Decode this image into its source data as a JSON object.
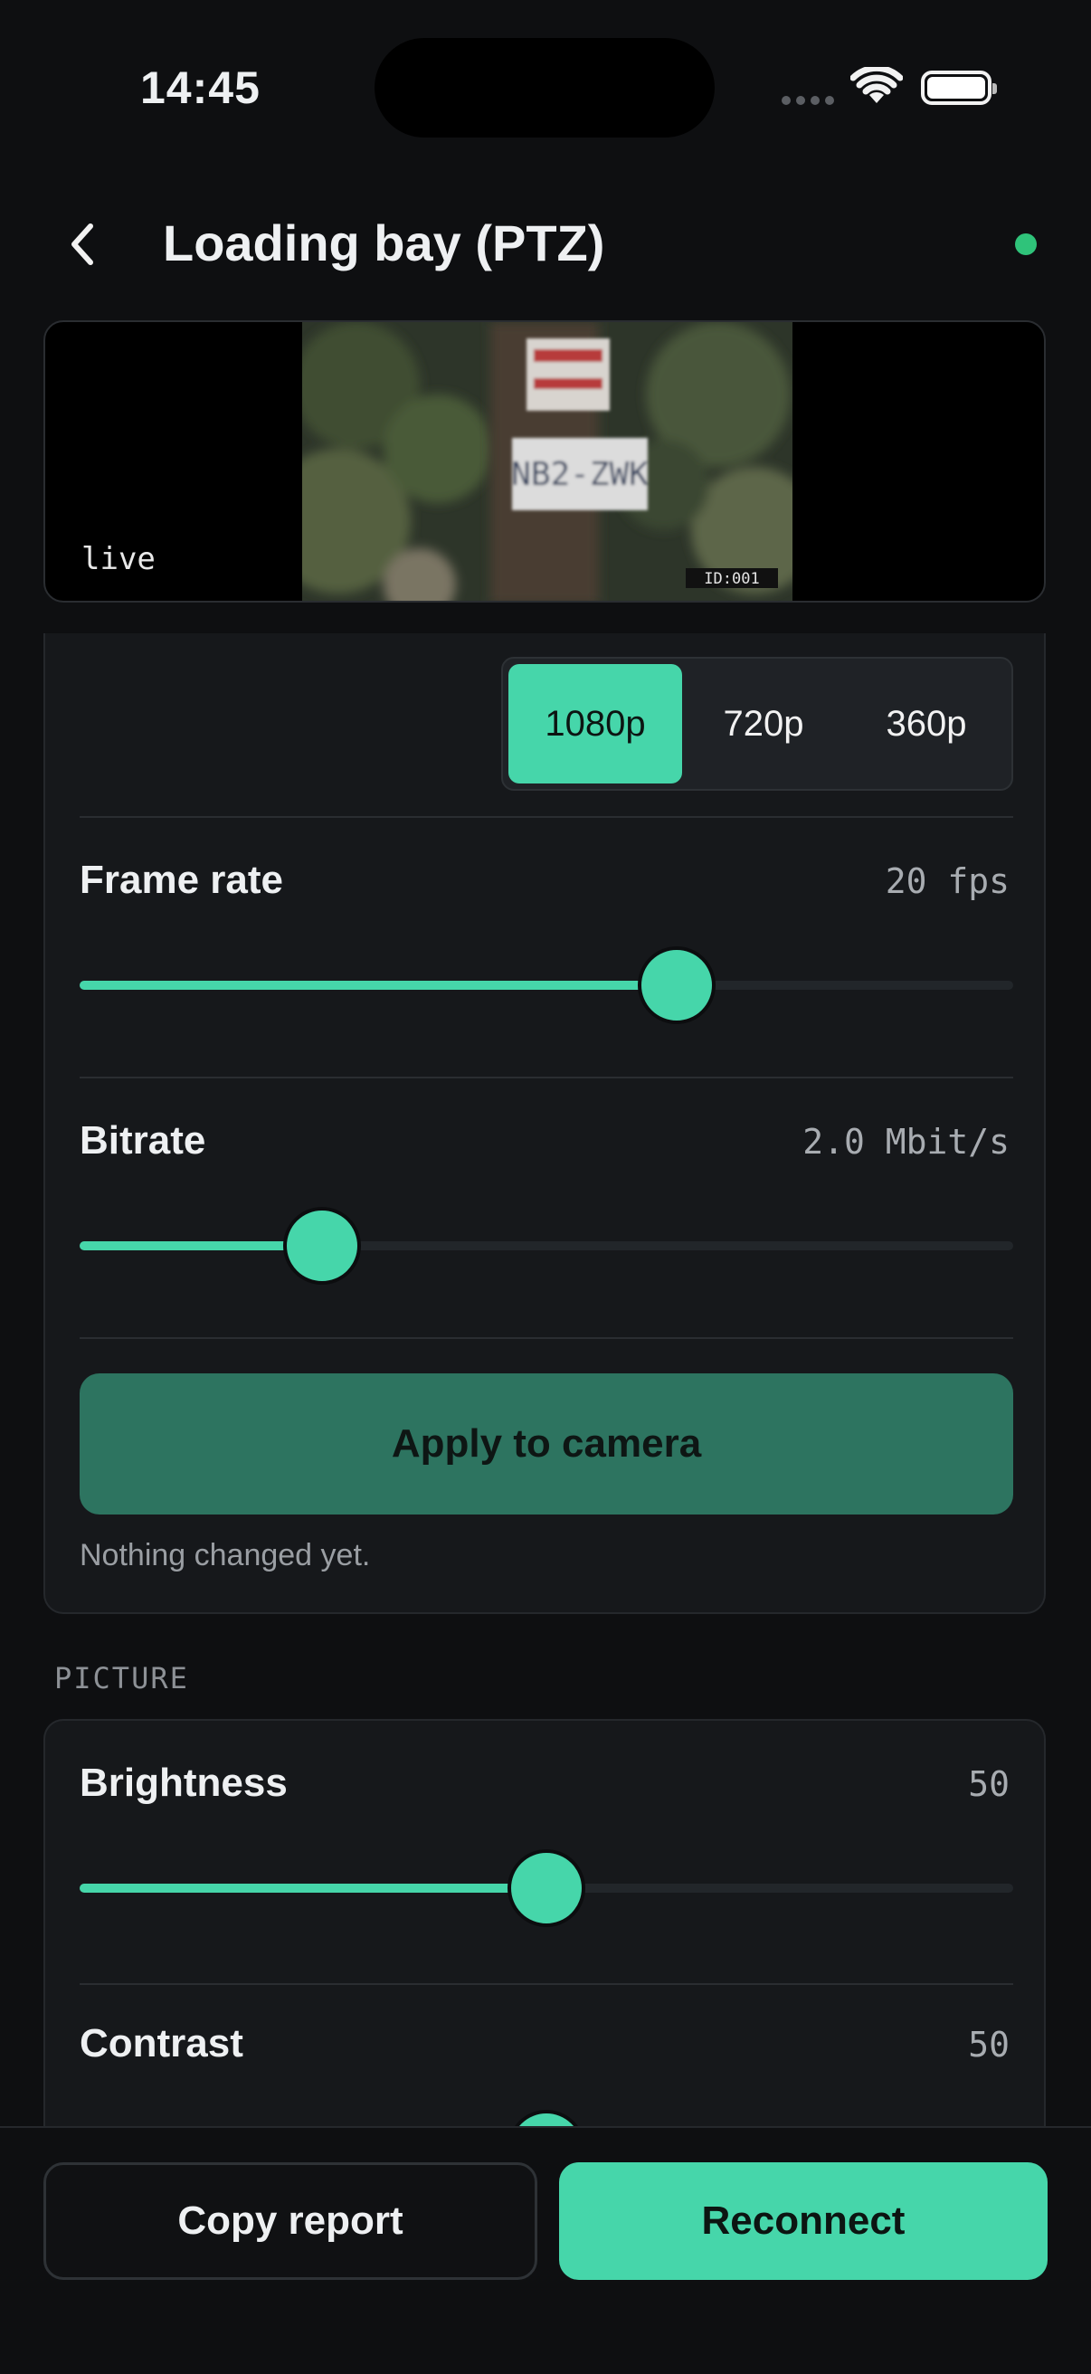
{
  "status_bar": {
    "time": "14:45"
  },
  "header": {
    "title": "Loading bay (PTZ)",
    "back_icon": "chevron-left-icon",
    "status_color": "#2fc37a"
  },
  "preview": {
    "badge": "live"
  },
  "stream": {
    "resolution_options": [
      "1080p",
      "720p",
      "360p"
    ],
    "resolution_selected": "1080p",
    "frame_rate": {
      "label": "Frame rate",
      "value": "20 fps",
      "level": 0.64
    },
    "bitrate": {
      "label": "Bitrate",
      "value": "2.0 Mbit/s",
      "level": 0.26
    },
    "apply_label": "Apply to camera",
    "note": "Nothing changed yet."
  },
  "picture": {
    "section_label": "PICTURE",
    "brightness": {
      "label": "Brightness",
      "value": "50",
      "level": 0.5
    },
    "contrast": {
      "label": "Contrast",
      "value": "50",
      "level": 0.5
    }
  },
  "actions": {
    "copy_label": "Copy report",
    "reconnect_label": "Reconnect"
  },
  "colors": {
    "accent": "#46d6aa",
    "apply_disabled": "#2d7460",
    "background": "#0e0f11",
    "card": "#16181b"
  }
}
